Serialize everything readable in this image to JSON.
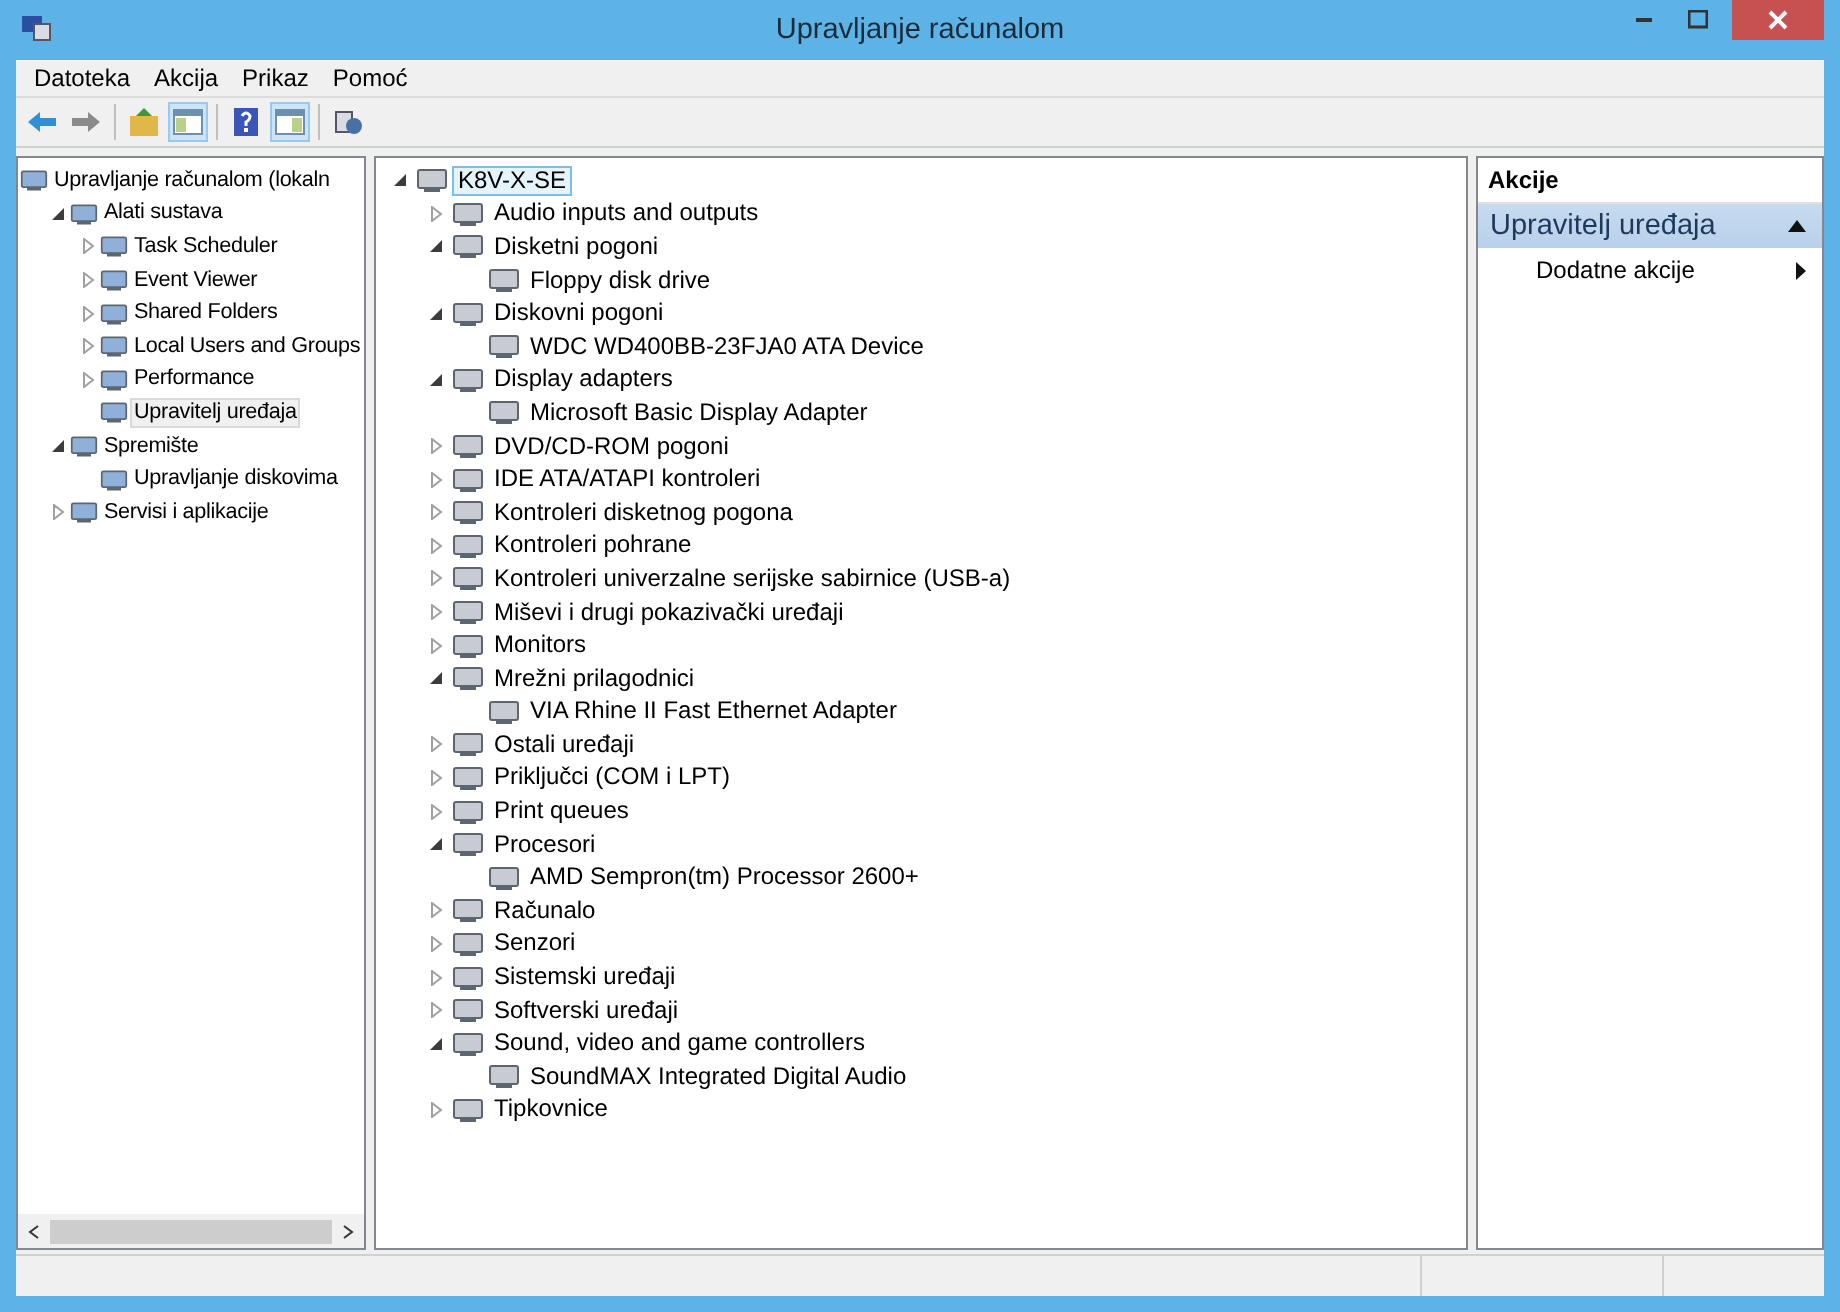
{
  "window": {
    "title": "Upravljanje računalom"
  },
  "menu": [
    "Datoteka",
    "Akcija",
    "Prikaz",
    "Pomoć"
  ],
  "toolbar": [
    {
      "kind": "back",
      "pressed": false
    },
    {
      "kind": "forward",
      "pressed": false
    },
    {
      "kind": "sep"
    },
    {
      "kind": "up",
      "pressed": false
    },
    {
      "kind": "tree",
      "pressed": true
    },
    {
      "kind": "sep"
    },
    {
      "kind": "help",
      "pressed": false
    },
    {
      "kind": "pane",
      "pressed": true
    },
    {
      "kind": "sep"
    },
    {
      "kind": "props",
      "pressed": false
    }
  ],
  "nav_tree": [
    {
      "label": "Upravljanje računalom (lokaln",
      "selected": false,
      "children": [
        {
          "label": "Alati sustava",
          "expanded": true,
          "selected": false,
          "children": [
            {
              "label": "Task Scheduler",
              "expanded": false,
              "selected": false
            },
            {
              "label": "Event Viewer",
              "expanded": false,
              "selected": false
            },
            {
              "label": "Shared Folders",
              "expanded": false,
              "selected": false
            },
            {
              "label": "Local Users and Groups",
              "expanded": false,
              "selected": false
            },
            {
              "label": "Performance",
              "expanded": false,
              "selected": false
            },
            {
              "label": "Upravitelj uređaja",
              "selected": true
            }
          ]
        },
        {
          "label": "Spremište",
          "expanded": true,
          "selected": false,
          "children": [
            {
              "label": "Upravljanje diskovima",
              "selected": false
            }
          ]
        },
        {
          "label": "Servisi i aplikacije",
          "expanded": false,
          "selected": false
        }
      ]
    }
  ],
  "device_tree": [
    {
      "label": "K8V-X-SE",
      "expanded": true,
      "selected": true,
      "children": [
        {
          "label": "Audio inputs and outputs",
          "expanded": false,
          "selected": false
        },
        {
          "label": "Disketni pogoni",
          "expanded": true,
          "selected": false,
          "children": [
            {
              "label": "Floppy disk drive",
              "selected": false
            }
          ]
        },
        {
          "label": "Diskovni pogoni",
          "expanded": true,
          "selected": false,
          "children": [
            {
              "label": "WDC WD400BB-23FJA0 ATA Device",
              "selected": false
            }
          ]
        },
        {
          "label": "Display adapters",
          "expanded": true,
          "selected": false,
          "children": [
            {
              "label": "Microsoft Basic Display Adapter",
              "selected": false
            }
          ]
        },
        {
          "label": "DVD/CD-ROM pogoni",
          "expanded": false,
          "selected": false
        },
        {
          "label": "IDE ATA/ATAPI kontroleri",
          "expanded": false,
          "selected": false
        },
        {
          "label": "Kontroleri disketnog pogona",
          "expanded": false,
          "selected": false
        },
        {
          "label": "Kontroleri pohrane",
          "expanded": false,
          "selected": false
        },
        {
          "label": "Kontroleri univerzalne serijske sabirnice (USB-a)",
          "expanded": false,
          "selected": false
        },
        {
          "label": "Miševi i drugi pokazivački uređaji",
          "expanded": false,
          "selected": false
        },
        {
          "label": "Monitors",
          "expanded": false,
          "selected": false
        },
        {
          "label": "Mrežni prilagodnici",
          "expanded": true,
          "selected": false,
          "children": [
            {
              "label": "VIA Rhine II Fast Ethernet Adapter",
              "selected": false
            }
          ]
        },
        {
          "label": "Ostali uređaji",
          "expanded": false,
          "selected": false
        },
        {
          "label": "Priključci (COM i LPT)",
          "expanded": false,
          "selected": false
        },
        {
          "label": "Print queues",
          "expanded": false,
          "selected": false
        },
        {
          "label": "Procesori",
          "expanded": true,
          "selected": false,
          "children": [
            {
              "label": "AMD Sempron(tm) Processor 2600+",
              "selected": false
            }
          ]
        },
        {
          "label": "Računalo",
          "expanded": false,
          "selected": false
        },
        {
          "label": "Senzori",
          "expanded": false,
          "selected": false
        },
        {
          "label": "Sistemski uređaji",
          "expanded": false,
          "selected": false
        },
        {
          "label": "Softverski uređaji",
          "expanded": false,
          "selected": false
        },
        {
          "label": "Sound, video and game controllers",
          "expanded": true,
          "selected": false,
          "children": [
            {
              "label": "SoundMAX Integrated Digital Audio",
              "selected": false
            }
          ]
        },
        {
          "label": "Tipkovnice",
          "expanded": false,
          "selected": false
        }
      ]
    }
  ],
  "actions": {
    "title": "Akcije",
    "section": {
      "label": "Upravitelj uređaja",
      "expanded": true
    },
    "items": [
      {
        "label": "Dodatne akcije"
      }
    ]
  }
}
